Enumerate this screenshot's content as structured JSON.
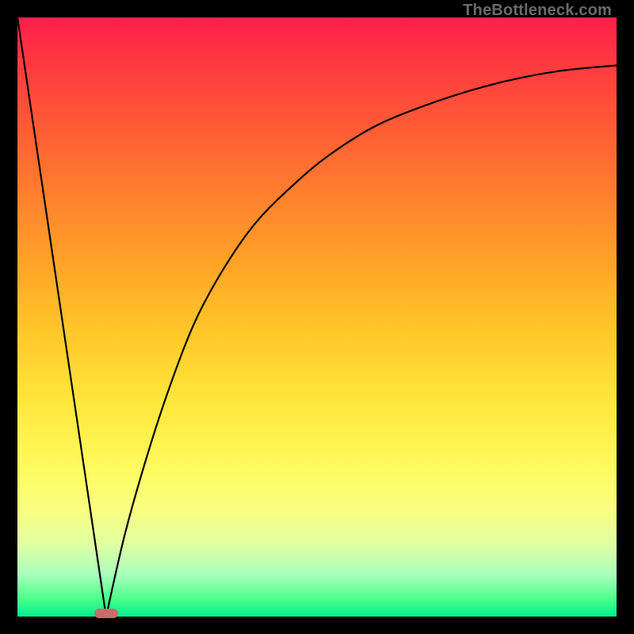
{
  "attribution": "TheBottleneck.com",
  "colors": {
    "frame": "#000000",
    "curve": "#000000",
    "marker": "#cb6b6b"
  },
  "chart_data": {
    "type": "line",
    "title": "",
    "xlabel": "",
    "ylabel": "",
    "xlim": [
      0,
      100
    ],
    "ylim": [
      0,
      100
    ],
    "grid": false,
    "series": [
      {
        "name": "left-branch",
        "x": [
          0,
          14.8
        ],
        "y": [
          100,
          0
        ]
      },
      {
        "name": "right-branch",
        "x": [
          14.8,
          18,
          22,
          26,
          30,
          35,
          40,
          46,
          52,
          60,
          70,
          80,
          90,
          100
        ],
        "y": [
          0,
          14,
          28,
          40,
          50,
          59,
          66,
          72,
          77,
          82,
          86,
          89,
          91,
          92
        ]
      }
    ],
    "annotations": [
      {
        "name": "minimum-marker",
        "x": 14.8,
        "y": 0,
        "shape": "rounded-rect",
        "color": "#cb6b6b"
      }
    ]
  }
}
